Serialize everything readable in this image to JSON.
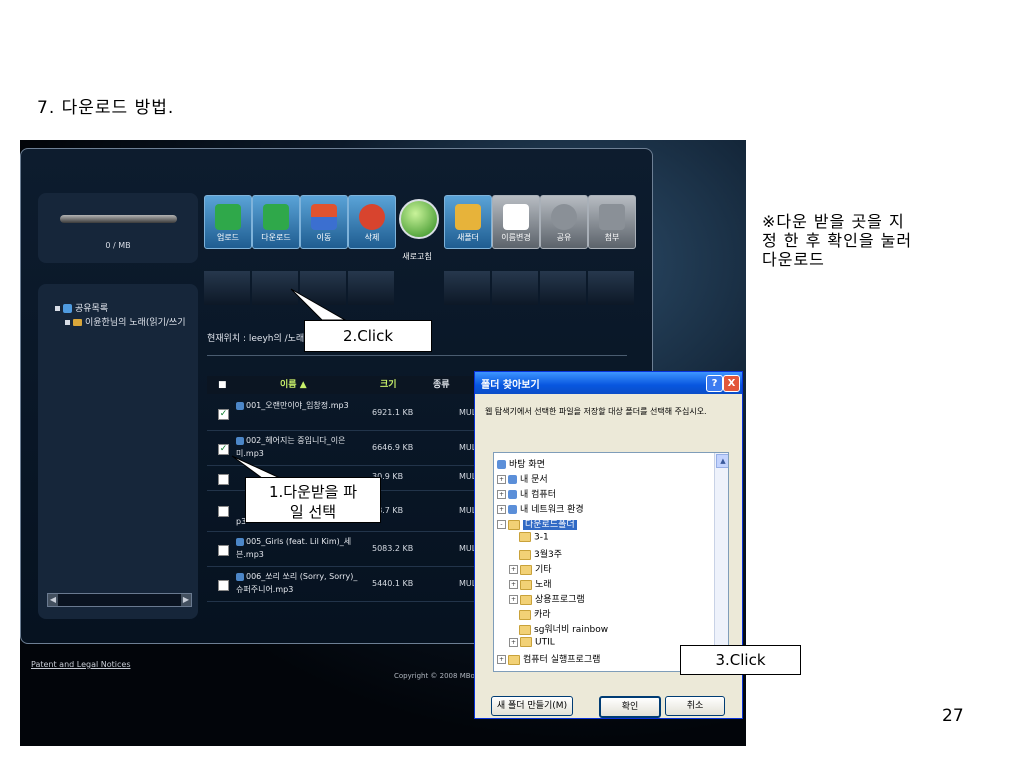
{
  "slide": {
    "title": "7. 다운로드 방법.",
    "side_note": "※다운 받을 곳을 지\n정 한 후 확인을 눌러\n다운로드",
    "page_number": "27"
  },
  "app": {
    "usage_text": "0 / MB",
    "toolbar": [
      {
        "label": "업로드",
        "icon": "upload-icon",
        "color": "#2fa84a"
      },
      {
        "label": "다운로드",
        "icon": "download-icon",
        "color": "#2fa84a"
      },
      {
        "label": "이동",
        "icon": "move-icon",
        "color": "#d8442e"
      },
      {
        "label": "삭제",
        "icon": "delete-icon",
        "color": "#d8442e"
      },
      {
        "label": "새로고침",
        "icon": "refresh-icon",
        "color": "#3aa32a"
      },
      {
        "label": "새폴더",
        "icon": "new-folder-icon",
        "color": "#e7b33a"
      },
      {
        "label": "이름변경",
        "icon": "rename-icon",
        "color": "#ffffff"
      },
      {
        "label": "공유",
        "icon": "share-icon",
        "color": "#8a9097"
      },
      {
        "label": "첨부",
        "icon": "attach-icon",
        "color": "#8a9097"
      }
    ],
    "tree": {
      "root": "공유목록",
      "child": "이윤한님의 노래(읽기/쓰기"
    },
    "current_path": "현재위치 : leeyh의 /노래(",
    "columns": {
      "name": "이름 ▲",
      "size": "크기",
      "kind": "종류"
    },
    "files": [
      {
        "name": "001_오랜만이야_임창정.mp3",
        "size": "6921.1 KB",
        "kind": "MUL",
        "checked": true
      },
      {
        "name": "002_헤어지는 중입니다_이은미.mp3",
        "size": "6646.9 KB",
        "kind": "MUL",
        "checked": true
      },
      {
        "name": "",
        "size": "30.9 KB",
        "kind": "MUL",
        "checked": false
      },
      {
        "name": "p3",
        "size": "38.7 KB",
        "kind": "MUL",
        "checked": false
      },
      {
        "name": "005_Girls (feat. Lil Kim)_세븐.mp3",
        "size": "5083.2 KB",
        "kind": "MUL",
        "checked": false
      },
      {
        "name": "006_쏘리 쏘리 (Sorry, Sorry)_슈퍼주니어.mp3",
        "size": "5440.1 KB",
        "kind": "MUL",
        "checked": false
      }
    ],
    "footer_link": "Patent and Legal Notices",
    "copyright": "Copyright © 2008 MBox"
  },
  "callouts": {
    "step1": "1.다운받을 파\n일 선택",
    "step2": "2.Click",
    "step3": "3.Click"
  },
  "dialog": {
    "title": "폴더 찾아보기",
    "help": "?",
    "close": "X",
    "message": "웹 탐색기에서 선택한 파일을 저장할 대상 폴더를 선택해 주십시오.",
    "tree": [
      {
        "label": "바탕 화면",
        "icon": "desktop-icon",
        "toggle": ""
      },
      {
        "label": "내 문서",
        "icon": "my-documents-icon",
        "toggle": "+"
      },
      {
        "label": "내 컴퓨터",
        "icon": "my-computer-icon",
        "toggle": "+"
      },
      {
        "label": "내 네트워크 환경",
        "icon": "network-icon",
        "toggle": "+"
      },
      {
        "label": "다운로드폴더",
        "icon": "folder-icon",
        "toggle": "-",
        "selected": true
      },
      {
        "label": "3-1",
        "icon": "folder-icon",
        "toggle": ""
      },
      {
        "label": "3월3주",
        "icon": "folder-icon",
        "toggle": ""
      },
      {
        "label": "기타",
        "icon": "folder-icon",
        "toggle": "+"
      },
      {
        "label": "노래",
        "icon": "folder-icon",
        "toggle": "+"
      },
      {
        "label": "상용프로그램",
        "icon": "folder-icon",
        "toggle": "+"
      },
      {
        "label": "카라",
        "icon": "folder-icon",
        "toggle": ""
      },
      {
        "label": "sg워너비 rainbow",
        "icon": "folder-icon",
        "toggle": ""
      },
      {
        "label": "UTIL",
        "icon": "folder-icon",
        "toggle": "+"
      },
      {
        "label": "컴퓨터 실행프로그램",
        "icon": "folder-icon",
        "toggle": "+"
      }
    ],
    "new_folder_button": "새 폴더 만들기(M)",
    "ok_button": "확인",
    "cancel_button": "취소"
  }
}
